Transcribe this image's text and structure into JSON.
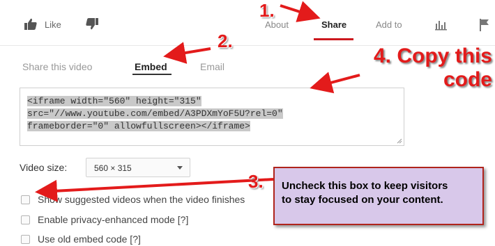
{
  "actions": {
    "like_label": "Like",
    "like_icon": "thumbs-up-icon",
    "dislike_icon": "thumbs-down-icon"
  },
  "tabs": [
    {
      "label": "About",
      "active": false
    },
    {
      "label": "Share",
      "active": true
    },
    {
      "label": "Add to",
      "active": false
    }
  ],
  "tab_icons": [
    "stats-icon",
    "flag-icon"
  ],
  "accent_color": "#cc181e",
  "share_tabs": [
    {
      "label": "Share this video",
      "active": false
    },
    {
      "label": "Embed",
      "active": true
    },
    {
      "label": "Email",
      "active": false
    }
  ],
  "embed_code": {
    "lines": [
      "<iframe width=\"560\" height=\"315\"",
      "src=\"//www.youtube.com/embed/A3PDXmYoF5U?rel=0\"",
      "frameborder=\"0\" allowfullscreen></iframe>"
    ],
    "selected": true
  },
  "video_size": {
    "label": "Video size:",
    "selected": "560 × 315"
  },
  "options": [
    {
      "label": "Show suggested videos when the video finishes",
      "checked": false
    },
    {
      "label": "Enable privacy-enhanced mode [?]",
      "checked": false
    },
    {
      "label": "Use old embed code [?]",
      "checked": false
    }
  ],
  "annotations": {
    "step1": "1.",
    "step2": "2.",
    "step3": "3.",
    "step4_line1": "4. Copy this",
    "step4_line2": "code",
    "callout_line1": "Uncheck this box to keep visitors",
    "callout_line2": "to stay focused on your content.",
    "color": "#e31b1b",
    "callout_bg": "#d8c8ea"
  }
}
